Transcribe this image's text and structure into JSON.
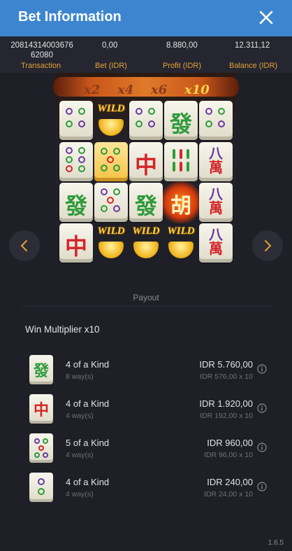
{
  "header": {
    "title": "Bet Information"
  },
  "summary": {
    "transaction_value": "20814314003676 62080",
    "transaction_label": "Transaction",
    "bet_value": "0,00",
    "bet_label": "Bet (IDR)",
    "profit_value": "8.880,00",
    "profit_label": "Profit (IDR)",
    "balance_value": "12.311,12",
    "balance_label": "Balance (IDR)"
  },
  "reels": {
    "multipliers": [
      "x2",
      "x4",
      "x6",
      "x10"
    ],
    "active_multiplier": "x10",
    "wild_label": "WILD",
    "tiles": {
      "fa": "發",
      "zhong": "中",
      "hu": "胡",
      "wan_top": "八",
      "wan_bottom": "萬"
    }
  },
  "payout": {
    "label": "Payout",
    "win_multiplier": "Win Multiplier x10",
    "rows": [
      {
        "symbol": "green-dragon",
        "glyph": "發",
        "kind": "4 of a Kind",
        "ways": "8 way(s)",
        "amount": "IDR 5.760,00",
        "calc": "IDR 576,00 x 10"
      },
      {
        "symbol": "red-dragon",
        "glyph": "中",
        "kind": "4 of a Kind",
        "ways": "4 way(s)",
        "amount": "IDR 1.920,00",
        "calc": "IDR 192,00 x 10"
      },
      {
        "symbol": "five-dots",
        "glyph": "",
        "kind": "5 of a Kind",
        "ways": "4 way(s)",
        "amount": "IDR 960,00",
        "calc": "IDR 96,00 x 10"
      },
      {
        "symbol": "two-dots",
        "glyph": "",
        "kind": "4 of a Kind",
        "ways": "4 way(s)",
        "amount": "IDR 240,00",
        "calc": "IDR 24,00 x 10"
      }
    ]
  },
  "footer": {
    "version": "1.6.5"
  },
  "colors": {
    "header": "#3d86cf",
    "accent_label": "#e6a23a",
    "background": "#1e1f27"
  }
}
